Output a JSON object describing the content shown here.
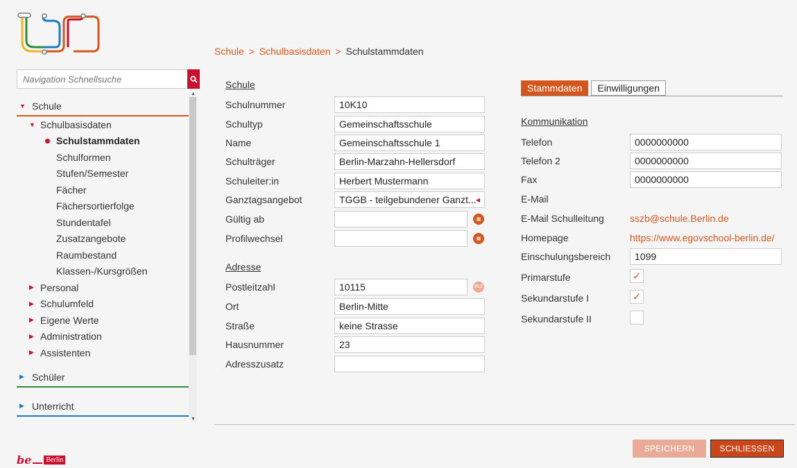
{
  "nav": {
    "search_placeholder": "Navigation Schnellsuche",
    "sections": {
      "schule": "Schule",
      "schueler": "Schüler",
      "unterricht": "Unterricht"
    },
    "schulbasisdaten": "Schulbasisdaten",
    "sub_items": [
      "Schulstammdaten",
      "Schulformen",
      "Stufen/Semester",
      "Fächer",
      "Fächersortierfolge",
      "Stundentafel",
      "Zusatzangebote",
      "Raumbestand",
      "Klassen-/Kursgrößen"
    ],
    "lvl1_items": [
      "Personal",
      "Schulumfeld",
      "Eigene Werte",
      "Administration",
      "Assistenten"
    ]
  },
  "breadcrumb": {
    "part1": "Schule",
    "sep1": ">",
    "part2": "Schulbasisdaten",
    "sep2": ">",
    "current": "Schulstammdaten"
  },
  "schule": {
    "title": "Schule",
    "labels": [
      "Schulnummer",
      "Schultyp",
      "Name",
      "Schulträger",
      "Schuleiter:in",
      "Ganztagsangebot",
      "Gültig ab",
      "Profilwechsel"
    ],
    "values": [
      "10K10",
      "Gemeinschaftsschule",
      "Gemeinschaftsschule 1",
      "Berlin-Marzahn-Hellersdorf",
      "Herbert Mustermann",
      "TGGB - teilgebundener Ganzt...",
      "",
      ""
    ]
  },
  "adresse": {
    "title": "Adresse",
    "labels": [
      "Postleitzahl",
      "Ort",
      "Straße",
      "Hausnummer",
      "Adresszusatz"
    ],
    "values": [
      "10115",
      "Berlin-Mitte",
      "keine Strasse",
      "23",
      ""
    ],
    "plz_icon": "PLZ"
  },
  "tabs": [
    "Stammdaten",
    "Einwilligungen"
  ],
  "kommunikation": {
    "title": "Kommunikation",
    "telefon_label": "Telefon",
    "telefon": "0000000000",
    "telefon2_label": "Telefon 2",
    "telefon2": "0000000000",
    "fax_label": "Fax",
    "fax": "0000000000",
    "email_label": "E-Mail",
    "email_sl_label": "E-Mail Schulleitung",
    "email_sl": "sszb@schule.Berlin.de",
    "homepage_label": "Homepage",
    "homepage": "https://www.egovschool-berlin.de/",
    "einschulung_label": "Einschulungsbereich",
    "einschulung": "1099",
    "primar_label": "Primarstufe",
    "primar_checked": true,
    "sek1_label": "Sekundarstufe I",
    "sek1_checked": true,
    "sek2_label": "Sekundarstufe II",
    "sek2_checked": false
  },
  "buttons": {
    "save": "SPEICHERN",
    "close": "SCHLIESSEN"
  },
  "footer_logo": {
    "be": "be",
    "berlin": "Berlin"
  },
  "colors": {
    "accent": "#d2561d",
    "red": "#c8102e",
    "green": "#2e8b3a",
    "blue": "#1a7bbf"
  }
}
